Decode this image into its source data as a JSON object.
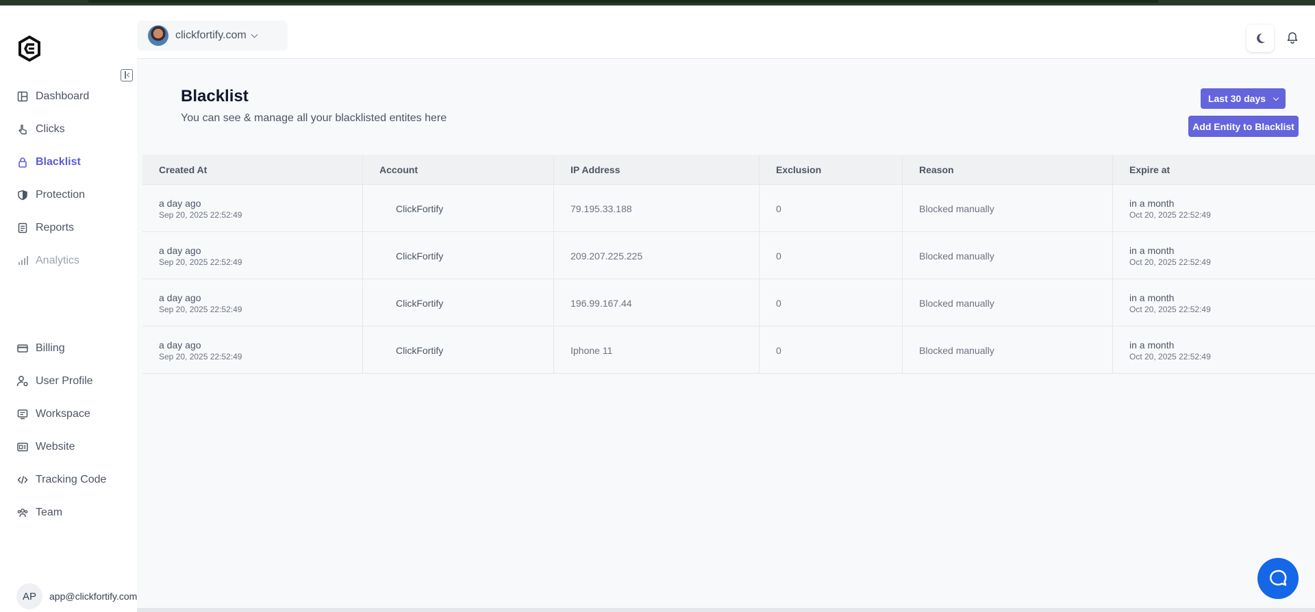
{
  "header": {
    "site_name": "clickfortify.com"
  },
  "sidebar": {
    "top_items": [
      {
        "label": "Dashboard",
        "icon": "layout-icon"
      },
      {
        "label": "Clicks",
        "icon": "pointer-icon"
      },
      {
        "label": "Blacklist",
        "icon": "lock-icon"
      },
      {
        "label": "Protection",
        "icon": "shield-icon"
      },
      {
        "label": "Reports",
        "icon": "document-icon"
      },
      {
        "label": "Analytics",
        "icon": "bar-chart-icon"
      }
    ],
    "bottom_items": [
      {
        "label": "Billing",
        "icon": "credit-card-icon"
      },
      {
        "label": "User Profile",
        "icon": "user-settings-icon"
      },
      {
        "label": "Workspace",
        "icon": "workspace-icon"
      },
      {
        "label": "Website",
        "icon": "website-icon"
      },
      {
        "label": "Tracking Code",
        "icon": "code-icon"
      },
      {
        "label": "Team",
        "icon": "team-icon"
      }
    ],
    "active": "Blacklist",
    "profile": {
      "initials": "AP",
      "email": "app@clickfortify.com"
    }
  },
  "page": {
    "title": "Blacklist",
    "subtitle": "You can see & manage all your blacklisted entites here",
    "range_button": "Last 30 days",
    "add_button": "Add Entity to Blacklist"
  },
  "table": {
    "columns": [
      "Created At",
      "Account",
      "IP Address",
      "Exclusion",
      "Reason",
      "Expire at"
    ],
    "rows": [
      {
        "created": "a day ago",
        "created_ts": "Sep 20, 2025 22:52:49",
        "account": "ClickFortify",
        "ip": "79.195.33.188",
        "exclusion": "0",
        "reason": "Blocked manually",
        "expire": "in a month",
        "expire_ts": "Oct 20, 2025 22:52:49"
      },
      {
        "created": "a day ago",
        "created_ts": "Sep 20, 2025 22:52:49",
        "account": "ClickFortify",
        "ip": "209.207.225.225",
        "exclusion": "0",
        "reason": "Blocked manually",
        "expire": "in a month",
        "expire_ts": "Oct 20, 2025 22:52:49"
      },
      {
        "created": "a day ago",
        "created_ts": "Sep 20, 2025 22:52:49",
        "account": "ClickFortify",
        "ip": "196.99.167.44",
        "exclusion": "0",
        "reason": "Blocked manually",
        "expire": "in a month",
        "expire_ts": "Oct 20, 2025 22:52:49"
      },
      {
        "created": "a day ago",
        "created_ts": "Sep 20, 2025 22:52:49",
        "account": "ClickFortify",
        "ip": "Iphone 11",
        "exclusion": "0",
        "reason": "Blocked manually",
        "expire": "in a month",
        "expire_ts": "Oct 20, 2025 22:52:49"
      }
    ]
  },
  "colors": {
    "accent": "#6464dc",
    "active_nav": "#5b5bd6",
    "chat": "#1467e6"
  }
}
